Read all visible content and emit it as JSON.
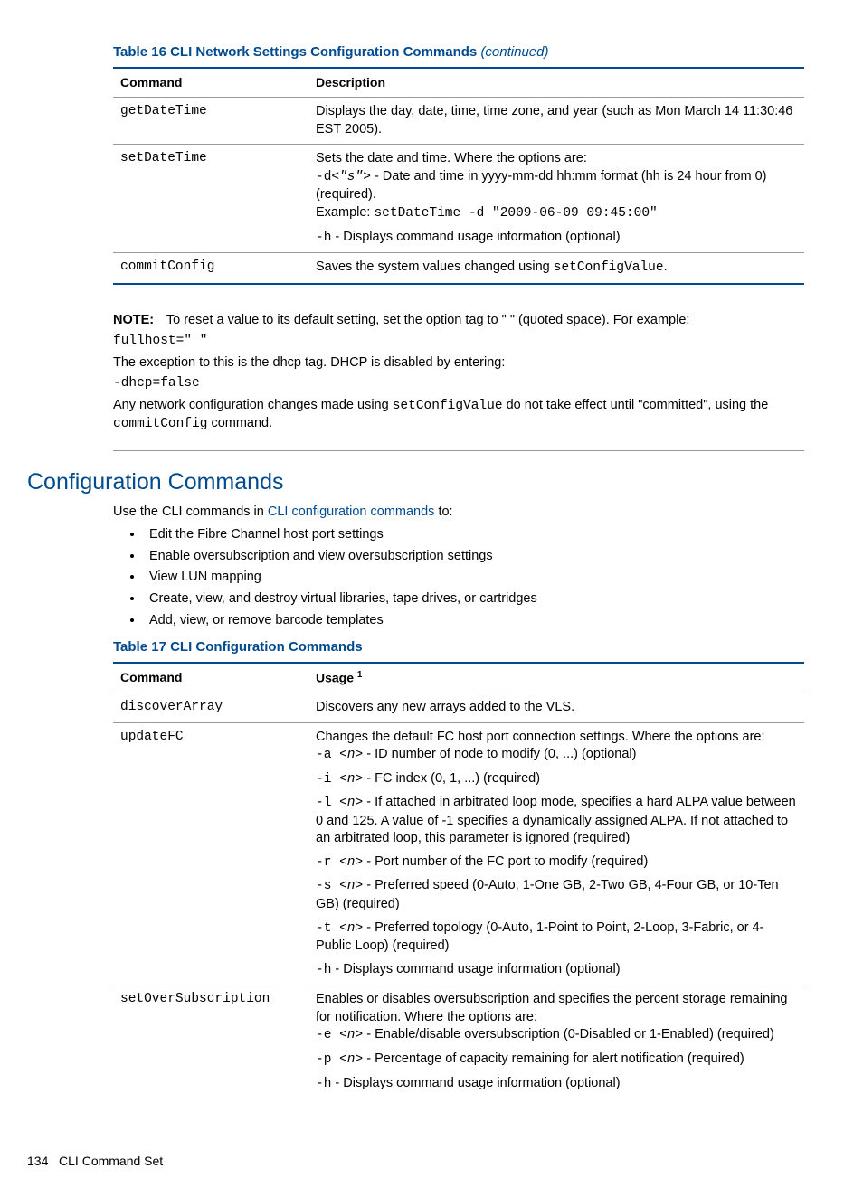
{
  "table16": {
    "title_prefix": "Table 16 CLI Network Settings Configuration Commands ",
    "title_suffix": "(continued)",
    "headers": {
      "c1": "Command",
      "c2": "Description"
    },
    "rows": {
      "r1": {
        "cmd": "getDateTime",
        "desc": "Displays the day, date, time, time zone, and year (such as Mon March 14 11:30:46 EST 2005)."
      },
      "r2": {
        "cmd": "setDateTime",
        "l1": "Sets the date and time. Where the options are:",
        "p1a": "-d",
        "p1b": "<\"s\">",
        "p1c": " - Date and time in yyyy-mm-dd hh:mm format (hh is 24 hour from 0) (required).",
        "ex_label": "Example: ",
        "ex_code": "setDateTime -d \"2009-06-09 09:45:00\"",
        "p2a": "-h",
        "p2b": " - Displays command usage information (optional)"
      },
      "r3": {
        "cmd": "commitConfig",
        "d1": "Saves the system values changed using ",
        "d2": "setConfigValue",
        "d3": "."
      }
    }
  },
  "note": {
    "label": "NOTE:",
    "p1": "To reset a value to its default setting, set the option tag to \" \" (quoted space). For example:",
    "code1": "fullhost=\" \"",
    "p2": "The exception to this is the dhcp tag. DHCP is disabled by entering:",
    "code2": "-dhcp=false",
    "p3a": "Any network configuration changes made using ",
    "p3b": "setConfigValue",
    "p3c": "  do not take effect until \"committed\", using the ",
    "p3d": "commitConfig",
    "p3e": " command."
  },
  "section": {
    "h2": "Configuration Commands",
    "intro_a": "Use the CLI commands in ",
    "intro_link": "CLI configuration commands",
    "intro_b": " to:",
    "bullets": [
      "Edit the Fibre Channel host port settings",
      "Enable oversubscription and view oversubscription settings",
      "View LUN mapping",
      "Create, view, and destroy virtual libraries, tape drives, or cartridges",
      "Add, view, or remove barcode templates"
    ]
  },
  "table17": {
    "title": "Table 17 CLI Configuration Commands",
    "headers": {
      "c1": "Command",
      "c2": "Usage ",
      "sup": "1"
    },
    "rows": {
      "r1": {
        "cmd": "discoverArray",
        "desc": "Discovers any new arrays added to the VLS."
      },
      "r2": {
        "cmd": "updateFC",
        "l1": "Changes the default FC host port connection settings. Where the options are:",
        "pa_a": "-a ",
        "pa_b": "<n>",
        "pa_c": " - ID number of node to modify (0, ...) (optional)",
        "pi_a": "-i ",
        "pi_b": "<n>",
        "pi_c": " - FC index (0, 1, ...) (required)",
        "pl_a": "-l ",
        "pl_b": "<n>",
        "pl_c": " - If attached in arbitrated loop mode, specifies a hard ALPA value between 0 and 125. A value of -1 specifies a dynamically assigned ALPA. If not attached to an arbitrated loop, this parameter is ignored (required)",
        "pr_a": "-r ",
        "pr_b": "<n>",
        "pr_c": " - Port number of the FC port to modify (required)",
        "ps_a": "-s ",
        "ps_b": "<n>",
        "ps_c": " - Preferred speed (0-Auto, 1-One GB, 2-Two GB, 4-Four GB, or 10-Ten GB) (required)",
        "pt_a": "-t ",
        "pt_b": "<n>",
        "pt_c": " - Preferred topology (0-Auto, 1-Point to Point, 2-Loop, 3-Fabric, or 4-Public Loop) (required)",
        "ph_a": "-h",
        "ph_c": " - Displays command usage information (optional)"
      },
      "r3": {
        "cmd": "setOverSubscription",
        "l1": "Enables or disables oversubscription and specifies the percent storage remaining for notification. Where the options are:",
        "pe_a": "-e ",
        "pe_b": "<n>",
        "pe_c": " - Enable/disable oversubscription (0-Disabled or 1-Enabled) (required)",
        "pp_a": "-p ",
        "pp_b": "<n>",
        "pp_c": " - Percentage of capacity remaining for alert notification (required)",
        "ph_a": "-h",
        "ph_c": " - Displays command usage information (optional)"
      }
    }
  },
  "footer": {
    "page": "134",
    "label": "CLI Command Set"
  }
}
